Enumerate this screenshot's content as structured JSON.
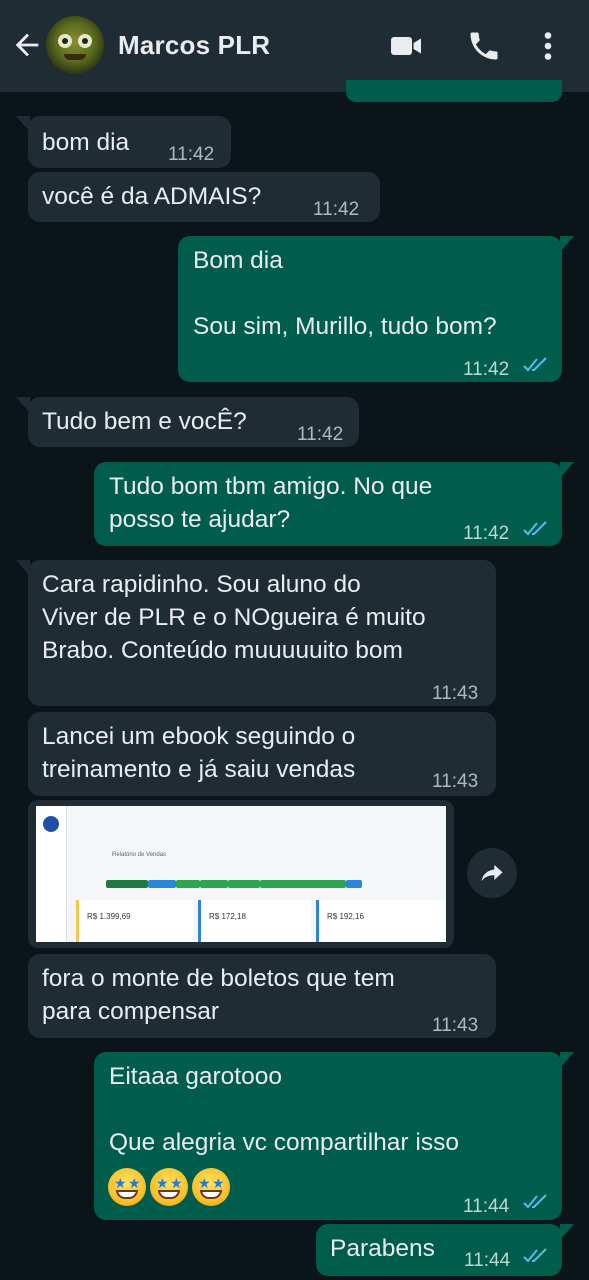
{
  "header": {
    "contact_name": "Marcos PLR",
    "icons": [
      "arrow-left-icon",
      "avatar",
      "video-camera-icon",
      "phone-icon",
      "more-vertical-icon"
    ]
  },
  "colors": {
    "header_bg": "#1f2c34",
    "chat_bg": "#0b1418",
    "incoming_bubble": "#1f2c34",
    "outgoing_bubble": "#005c4b",
    "read_ticks": "#53bdeb"
  },
  "messages": [
    {
      "dir": "in",
      "text": "bom dia",
      "time": "11:42"
    },
    {
      "dir": "in",
      "text": "você é da ADMAIS?",
      "time": "11:42"
    },
    {
      "dir": "out",
      "text": "Bom dia\n\nSou sim, Murillo, tudo bom?",
      "time": "11:42",
      "status": "read"
    },
    {
      "dir": "in",
      "text": "Tudo bem e vocÊ?",
      "time": "11:42"
    },
    {
      "dir": "out",
      "text": "Tudo bom tbm amigo. No que\nposso te ajudar?",
      "time": "11:42",
      "status": "read"
    },
    {
      "dir": "in",
      "text": "Cara rapidinho. Sou aluno do\nViver de PLR e o NOgueira é muito\nBrabo. Conteúdo muuuuuito bom",
      "time": "11:43"
    },
    {
      "dir": "in",
      "text": "Lancei um ebook seguindo o\ntreinamento e já saiu vendas",
      "time": "11:43"
    },
    {
      "dir": "in",
      "type": "image",
      "time": "11:43",
      "image": {
        "title": "Relatório de Vendas",
        "card_values": [
          "R$ 1.399,69",
          "R$ 172,18",
          "R$ 192,16"
        ]
      }
    },
    {
      "dir": "in",
      "text": "fora o monte de boletos que tem\npara compensar",
      "time": "11:43"
    },
    {
      "dir": "out",
      "text": "Eitaaa garotooo\n\nQue alegria vc compartilhar isso",
      "emoji": [
        "star-struck-emoji",
        "star-struck-emoji",
        "star-struck-emoji"
      ],
      "time": "11:44",
      "status": "read"
    },
    {
      "dir": "out",
      "text": "Parabens",
      "time": "11:44",
      "status": "read"
    }
  ]
}
